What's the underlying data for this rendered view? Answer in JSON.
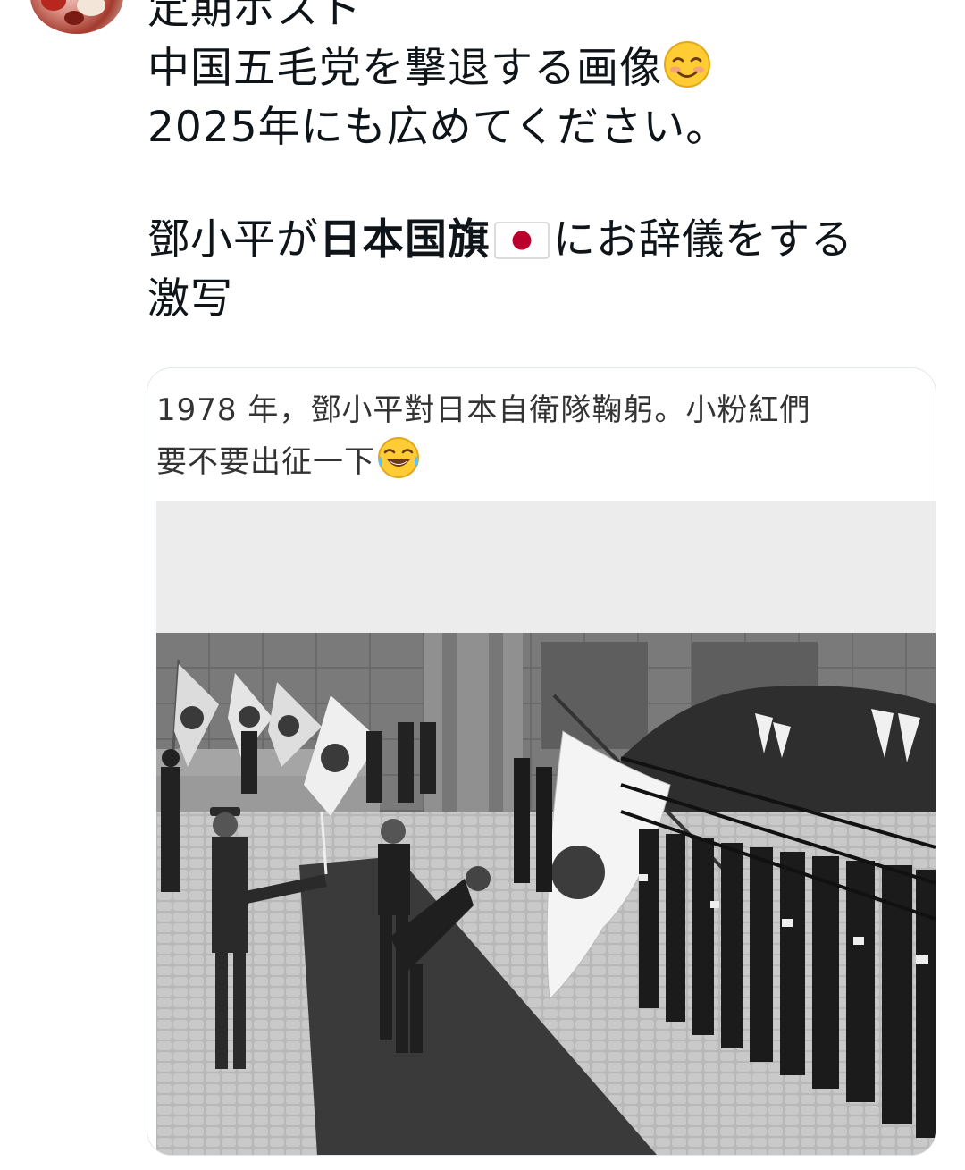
{
  "post": {
    "lines": [
      "定期ポスト",
      "中国五毛党を撃退する画像",
      "2025年にも広めてください。",
      "鄧小平が",
      "日本国旗",
      "にお辞儀をする",
      "激写"
    ],
    "emoji_smile": "smiling-face-emoji",
    "emoji_flag": "japan-flag-emoji"
  },
  "card": {
    "caption_line1": "1978 年，鄧小平對日本自衛隊鞠躬。小粉紅們",
    "caption_line2": "要不要出征一下",
    "emoji": "tears-of-joy-emoji"
  },
  "colors": {
    "text": "#0f1419",
    "card_border": "#e1e8ed",
    "flag_red": "#bc002d",
    "emoji_yellow": "#ffcc33"
  }
}
